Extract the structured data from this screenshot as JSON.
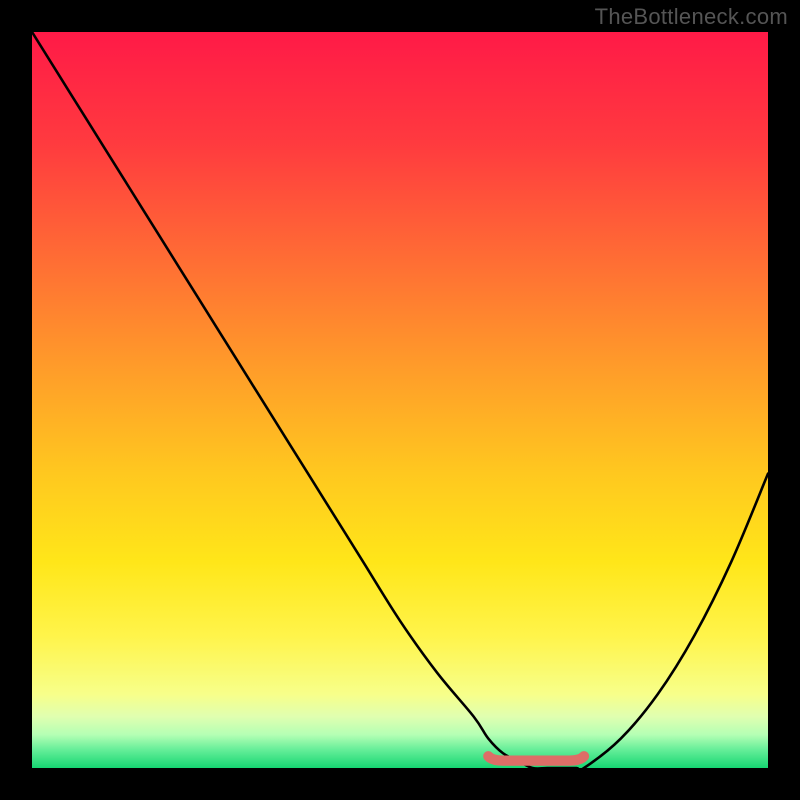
{
  "watermark": "TheBottleneck.com",
  "chart_data": {
    "type": "line",
    "title": "",
    "xlabel": "",
    "ylabel": "",
    "xlim": [
      0,
      100
    ],
    "ylim": [
      0,
      100
    ],
    "series": [
      {
        "name": "bottleneck-curve",
        "x": [
          0,
          5,
          10,
          15,
          20,
          25,
          30,
          35,
          40,
          45,
          50,
          55,
          60,
          62,
          64,
          66,
          68,
          70,
          72,
          74,
          75,
          80,
          85,
          90,
          95,
          100
        ],
        "y": [
          100,
          92,
          84,
          76,
          68,
          60,
          52,
          44,
          36,
          28,
          20,
          13,
          7,
          4,
          2,
          1,
          0,
          0,
          0,
          0,
          0,
          4,
          10,
          18,
          28,
          40
        ]
      }
    ],
    "optimal_zone": {
      "x_start": 62,
      "x_end": 75,
      "y": 0
    },
    "background_gradient": {
      "stops": [
        {
          "offset": 0.0,
          "color": "#ff1a47"
        },
        {
          "offset": 0.15,
          "color": "#ff3a3f"
        },
        {
          "offset": 0.3,
          "color": "#ff6a35"
        },
        {
          "offset": 0.45,
          "color": "#ff9a2a"
        },
        {
          "offset": 0.6,
          "color": "#ffc81f"
        },
        {
          "offset": 0.72,
          "color": "#ffe619"
        },
        {
          "offset": 0.82,
          "color": "#fff44a"
        },
        {
          "offset": 0.9,
          "color": "#f7ff8a"
        },
        {
          "offset": 0.93,
          "color": "#e0ffb0"
        },
        {
          "offset": 0.955,
          "color": "#b4ffb4"
        },
        {
          "offset": 0.975,
          "color": "#66ee99"
        },
        {
          "offset": 1.0,
          "color": "#16d672"
        }
      ]
    },
    "optimal_marker_color": "#dd6e67",
    "curve_color": "#000000"
  }
}
